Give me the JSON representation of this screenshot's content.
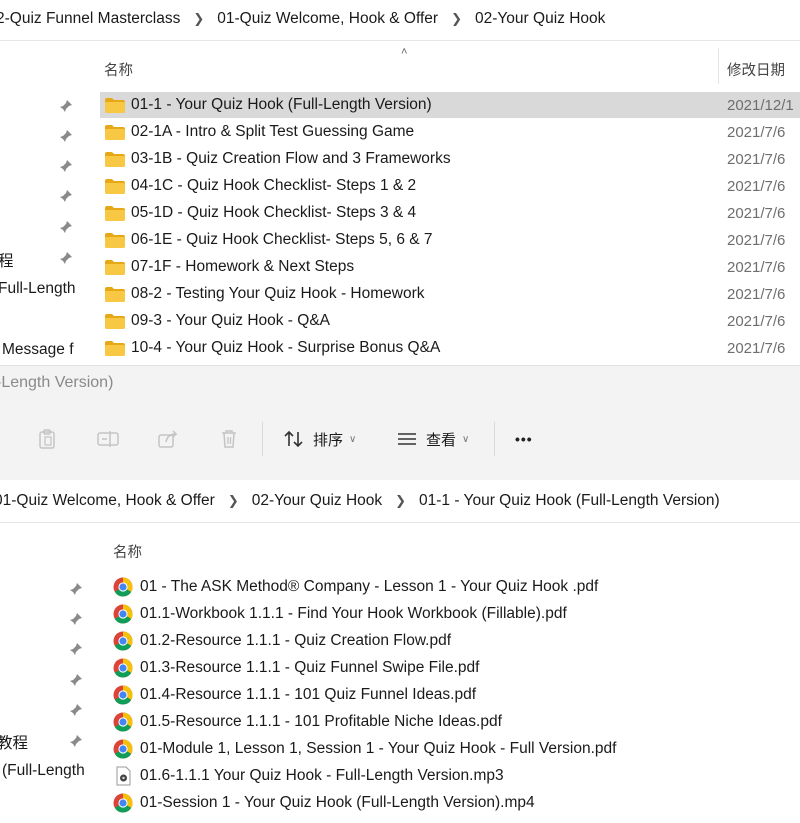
{
  "top": {
    "breadcrumb": [
      "2-Quiz Funnel Masterclass",
      "01-Quiz Welcome, Hook & Offer",
      "02-Your Quiz Hook"
    ],
    "columns": {
      "name": "名称",
      "modified": "修改日期"
    },
    "sidebar_texts": [
      "程",
      "Full-Length",
      "Message f"
    ],
    "rows": [
      {
        "name": "01-1 - Your Quiz Hook (Full-Length Version)",
        "date": "2021/12/1",
        "selected": true
      },
      {
        "name": "02-1A - Intro & Split Test Guessing Game",
        "date": "2021/7/6"
      },
      {
        "name": "03-1B - Quiz Creation Flow and 3 Frameworks",
        "date": "2021/7/6"
      },
      {
        "name": "04-1C - Quiz Hook Checklist- Steps 1 & 2",
        "date": "2021/7/6"
      },
      {
        "name": "05-1D - Quiz Hook Checklist- Steps 3 & 4",
        "date": "2021/7/6"
      },
      {
        "name": "06-1E - Quiz Hook Checklist- Steps 5, 6 & 7",
        "date": "2021/7/6"
      },
      {
        "name": "07-1F - Homework & Next Steps",
        "date": "2021/7/6"
      },
      {
        "name": "08-2 - Testing Your Quiz Hook - Homework",
        "date": "2021/7/6"
      },
      {
        "name": "09-3 - Your Quiz Hook - Q&A",
        "date": "2021/7/6"
      },
      {
        "name": "10-4 - Your Quiz Hook - Surprise Bonus Q&A",
        "date": "2021/7/6"
      }
    ]
  },
  "mid": {
    "title": "-Length Version)",
    "toolbar": {
      "sort_label": "排序",
      "view_label": "查看",
      "more_label": "•••"
    }
  },
  "bottom": {
    "breadcrumb": [
      "01-Quiz Welcome, Hook & Offer",
      "02-Your Quiz Hook",
      "01-1 - Your Quiz Hook (Full-Length Version)"
    ],
    "columns": {
      "name": "名称"
    },
    "sidebar_texts": [
      "教程",
      "(Full-Length"
    ],
    "files": [
      {
        "name": "01 - The ASK Method® Company - Lesson 1 - Your Quiz Hook .pdf",
        "icon": "chrome-icon"
      },
      {
        "name": "01.1-Workbook 1.1.1 - Find Your Hook Workbook (Fillable).pdf",
        "icon": "chrome-icon"
      },
      {
        "name": "01.2-Resource 1.1.1 - Quiz Creation Flow.pdf",
        "icon": "chrome-icon"
      },
      {
        "name": "01.3-Resource 1.1.1 - Quiz Funnel Swipe File.pdf",
        "icon": "chrome-icon"
      },
      {
        "name": "01.4-Resource 1.1.1 - 101 Quiz Funnel Ideas.pdf",
        "icon": "chrome-icon"
      },
      {
        "name": "01.5-Resource 1.1.1 - 101 Profitable Niche Ideas.pdf",
        "icon": "chrome-icon"
      },
      {
        "name": "01-Module 1, Lesson 1, Session 1 - Your Quiz Hook - Full Version.pdf",
        "icon": "chrome-icon"
      },
      {
        "name": "01.6-1.1.1 Your Quiz Hook - Full-Length Version.mp3",
        "icon": "audio-file-icon"
      },
      {
        "name": "01-Session 1 - Your Quiz Hook (Full-Length Version).mp4",
        "icon": "chrome-icon"
      }
    ]
  },
  "colors": {
    "folder": "#f8c844",
    "folder_dark": "#e6a817",
    "selected_row": "#d9d9d9",
    "chrome_red": "#db4437",
    "chrome_yellow": "#f4c20d",
    "chrome_green": "#0f9d58",
    "chrome_blue": "#4285f4"
  }
}
